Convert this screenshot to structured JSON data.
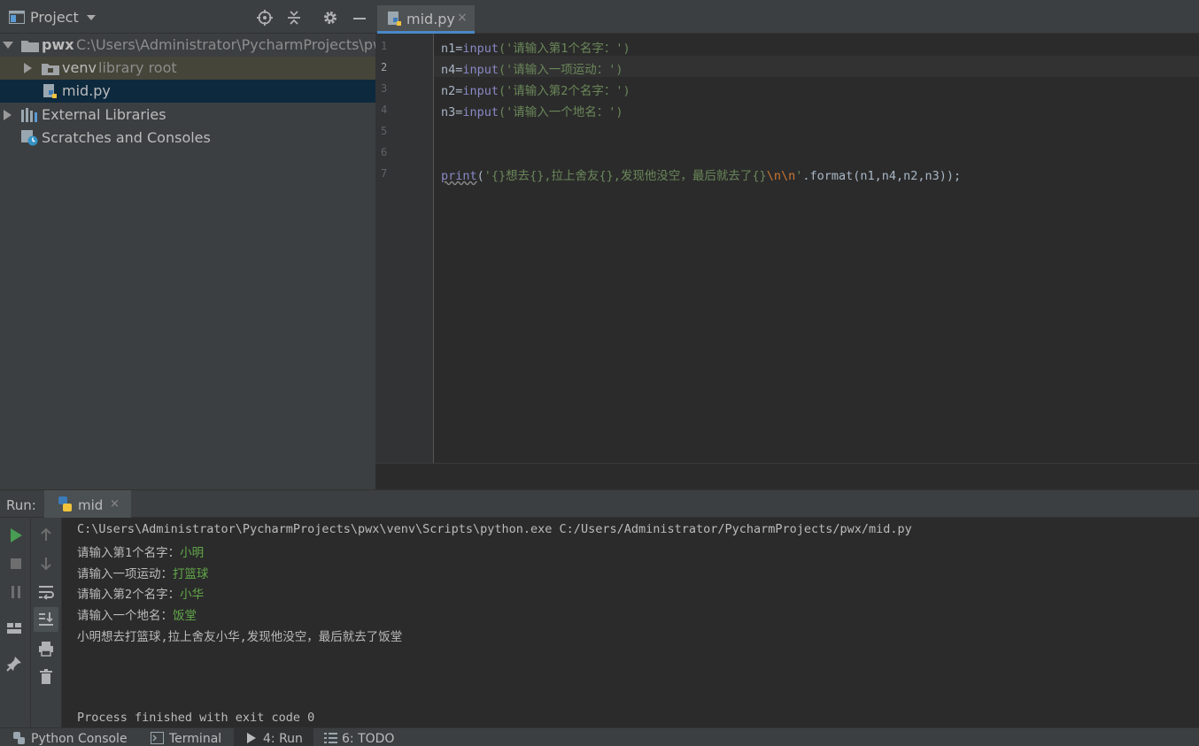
{
  "project_panel": {
    "title": "Project",
    "tree": [
      {
        "name": "pwx",
        "path": "C:\\Users\\Administrator\\PycharmProjects\\pwx"
      },
      {
        "name": "venv",
        "note": "library root"
      },
      {
        "name": "mid.py"
      },
      {
        "name": "External Libraries"
      },
      {
        "name": "Scratches and Consoles"
      }
    ]
  },
  "editor": {
    "tab": {
      "label": "mid.py",
      "close": "×"
    },
    "line_numbers": [
      "1",
      "2",
      "3",
      "4",
      "5",
      "6",
      "7"
    ],
    "code": [
      {
        "var": "n1",
        "op": "=",
        "fn": "input",
        "arg": "('请输入第1个名字：')"
      },
      {
        "var": "n4",
        "op": "=",
        "fn": "input",
        "arg": "('请输入一项运动：')"
      },
      {
        "var": "n2",
        "op": "=",
        "fn": "input",
        "arg": "('请输入第2个名字：')"
      },
      {
        "var": "n3",
        "op": "=",
        "fn": "input",
        "arg": "('请输入一个地名：')"
      },
      {
        "fn": "print",
        "open": "(",
        "str": "'{}想去{},拉上舍友{},发现他没空，最后就去了{}",
        "esc": "\\n\\n",
        "close_q": "'",
        "rest": ".format(n1,n4,n2,n3));"
      }
    ]
  },
  "run_panel": {
    "label": "Run:",
    "tab": {
      "label": "mid",
      "close": "×"
    },
    "console": [
      {
        "prompt": "C:\\Users\\Administrator\\PycharmProjects\\pwx\\venv\\Scripts\\python.exe C:/Users/Administrator/PycharmProjects/pwx/mid.py",
        "input": ""
      },
      {
        "prompt": "请输入第1个名字：",
        "input": "小明"
      },
      {
        "prompt": "请输入一项运动：",
        "input": "打篮球"
      },
      {
        "prompt": "请输入第2个名字：",
        "input": "小华"
      },
      {
        "prompt": "请输入一个地名：",
        "input": "饭堂"
      },
      {
        "prompt": "小明想去打篮球,拉上舍友小华,发现他没空，最后就去了饭堂",
        "input": ""
      }
    ],
    "finished": "Process finished with exit code 0"
  },
  "bottom_bar": {
    "items": [
      "Python Console",
      "Terminal",
      "4: Run",
      "6: TODO"
    ]
  },
  "colors": {
    "accent": "#4a88c7",
    "run_green": "#499c54",
    "console_input": "#62a84a"
  }
}
